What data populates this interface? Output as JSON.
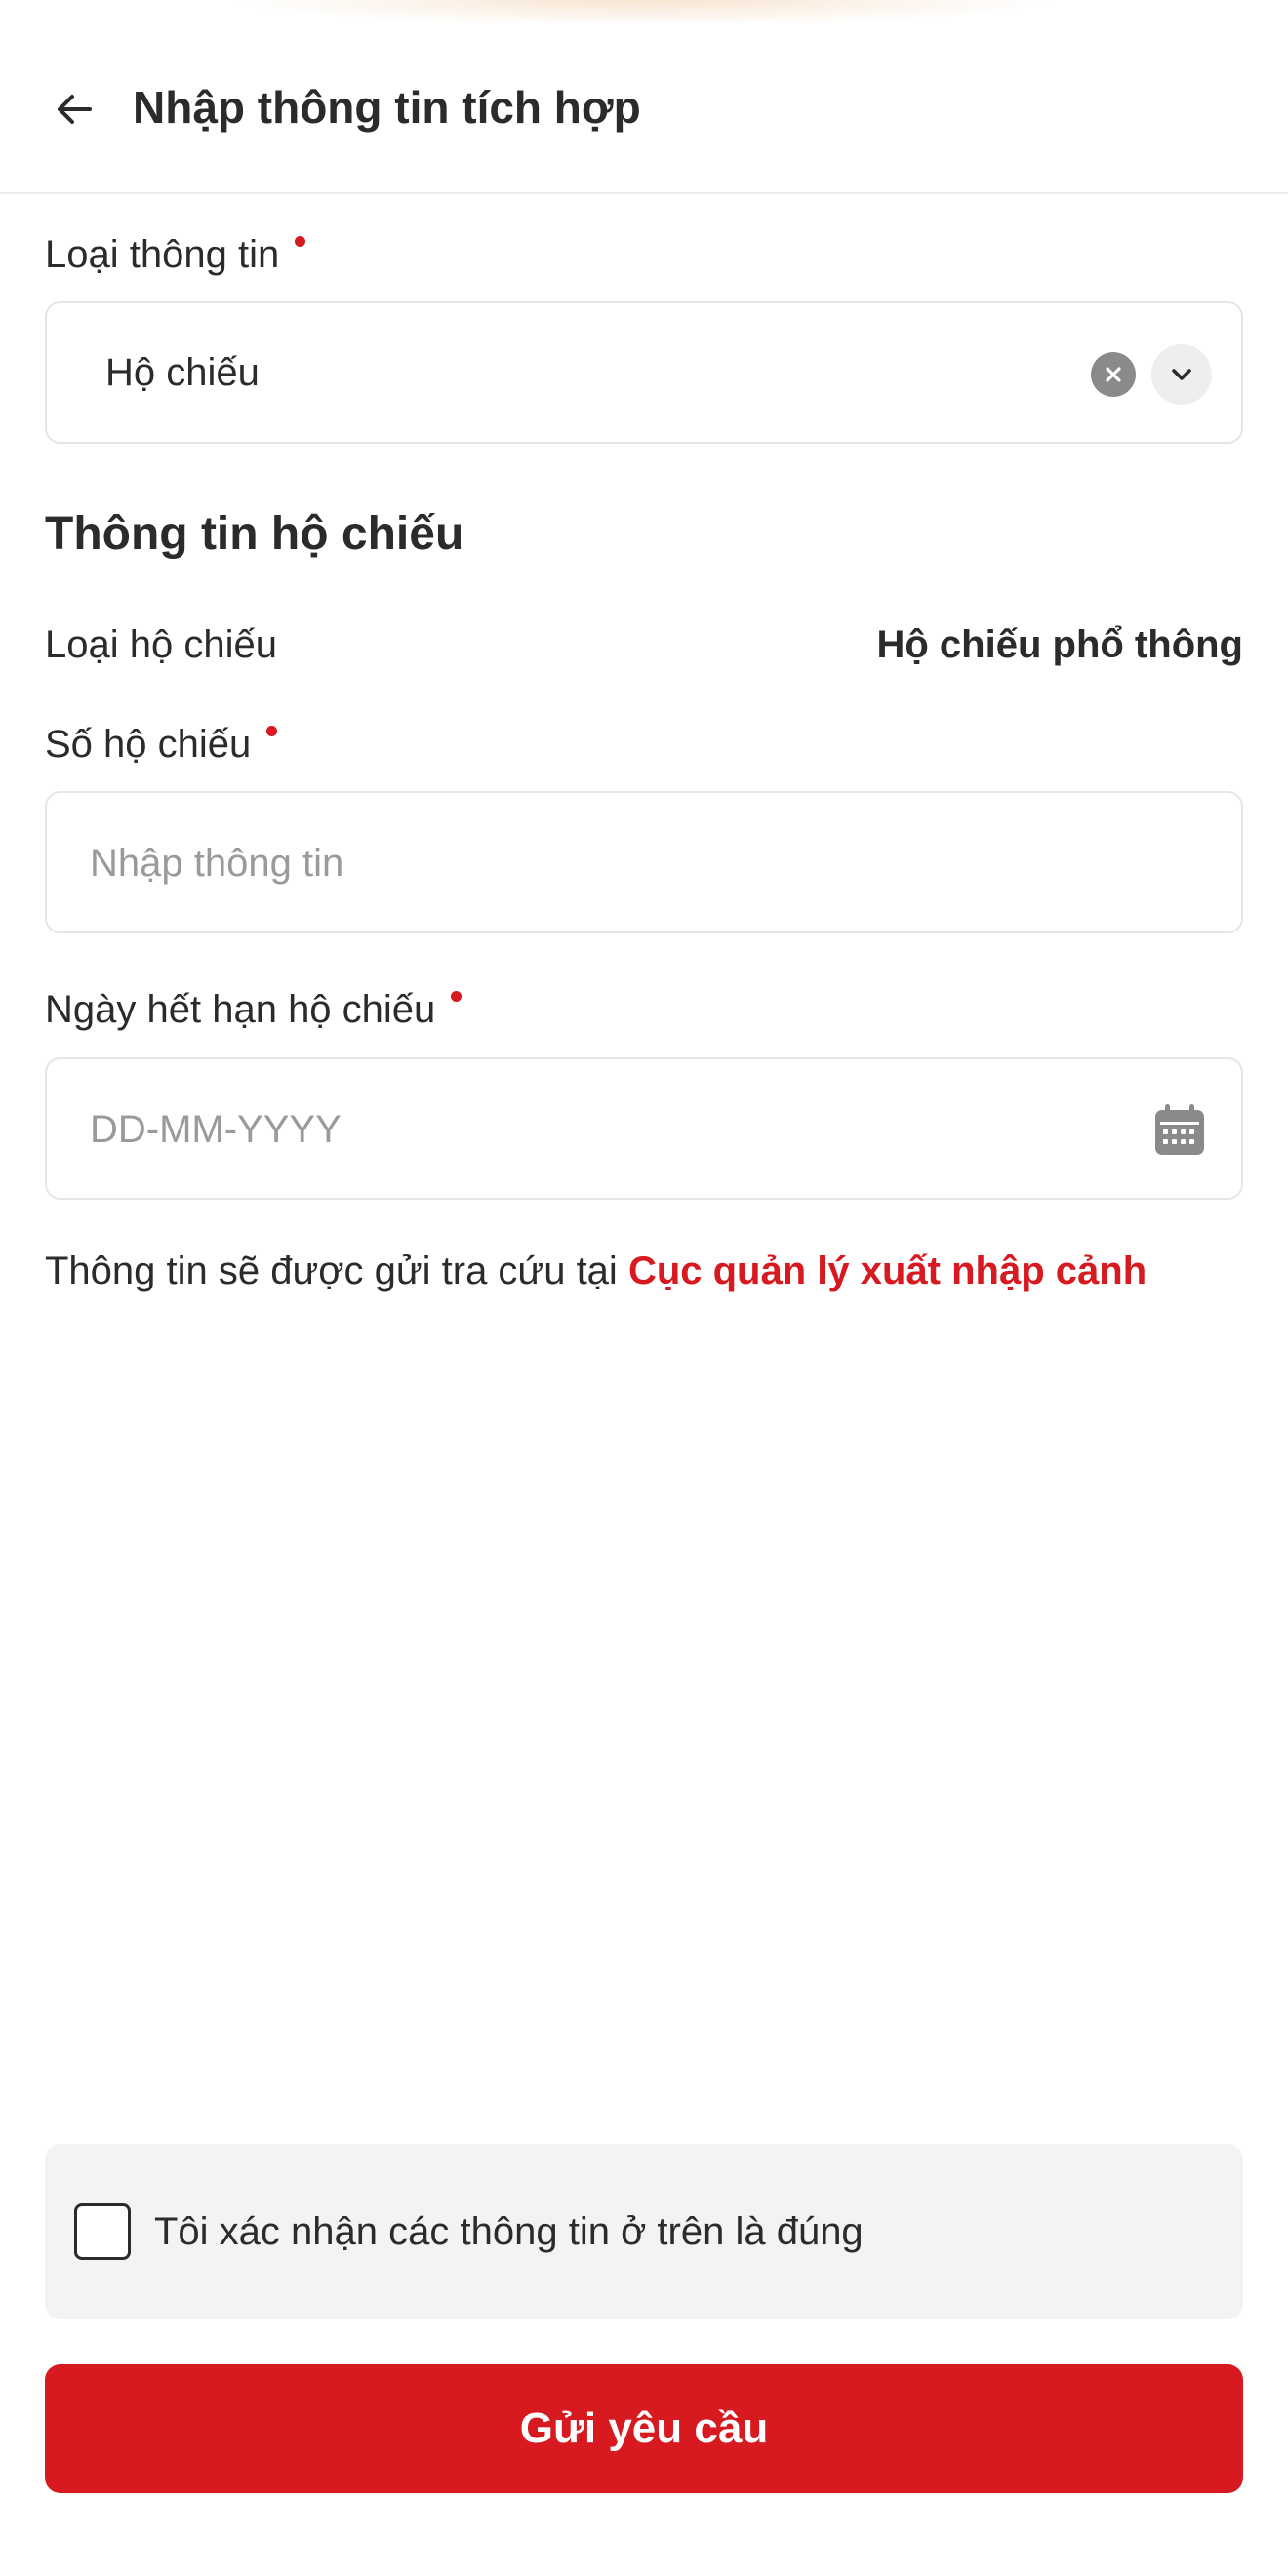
{
  "header": {
    "title": "Nhập thông tin tích hợp",
    "back_icon": "arrow-left-icon"
  },
  "info_type": {
    "label": "Loại thông tin",
    "selected": "Hộ chiếu",
    "clear_icon": "close-circle-icon",
    "dropdown_icon": "chevron-down-icon"
  },
  "passport": {
    "section_title": "Thông tin hộ chiếu",
    "type_label": "Loại hộ chiếu",
    "type_value": "Hộ chiếu phổ thông",
    "number_label": "Số hộ chiếu",
    "number_placeholder": "Nhập thông tin",
    "number_value": "",
    "expiry_label": "Ngày hết hạn hộ chiếu",
    "expiry_placeholder": "DD-MM-YYYY",
    "expiry_value": "",
    "calendar_icon": "calendar-icon"
  },
  "note": {
    "text": "Thông tin sẽ được gửi tra cứu tại ",
    "agency": "Cục quản lý xuất nhập cảnh"
  },
  "confirm": {
    "text": "Tôi xác nhận các thông tin ở trên là đúng",
    "checked": false
  },
  "submit": {
    "label": "Gửi yêu cầu"
  },
  "colors": {
    "accent": "#d71920",
    "text": "#2b2b2b",
    "placeholder": "#9a9a9a",
    "border": "#e6e6e6",
    "confirm_bg": "#f3f3f3"
  }
}
